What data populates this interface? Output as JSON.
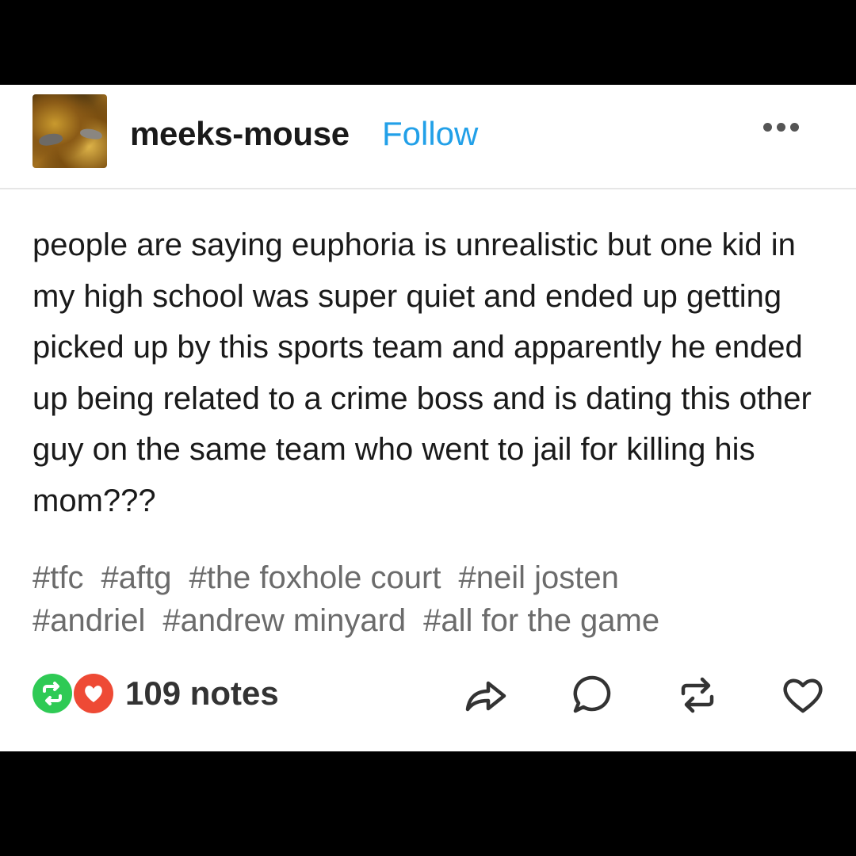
{
  "post": {
    "username": "meeks-mouse",
    "follow_label": "Follow",
    "body": "people are saying euphoria is unrealistic but one kid in my high school was super quiet and ended up getting picked up by this sports team and apparently he ended up being related to a crime boss and is dating this other guy on the same team who went to jail for killing his mom???",
    "tags": [
      "#tfc",
      "#aftg",
      "#the foxhole court",
      "#neil josten",
      "#andriel",
      "#andrew minyard",
      "#all for the game"
    ],
    "notes_label": "109 notes"
  },
  "icons": {
    "more": "more-options-icon",
    "reblog_badge": "reblog-badge-icon",
    "like_badge": "like-badge-icon",
    "share": "share-icon",
    "reply": "reply-icon",
    "reblog": "reblog-icon",
    "like": "heart-icon"
  },
  "colors": {
    "follow": "#22a0e8",
    "reblog_badge": "#2fca55",
    "like_badge": "#ee4a35",
    "tag_text": "#6b6b6b"
  }
}
